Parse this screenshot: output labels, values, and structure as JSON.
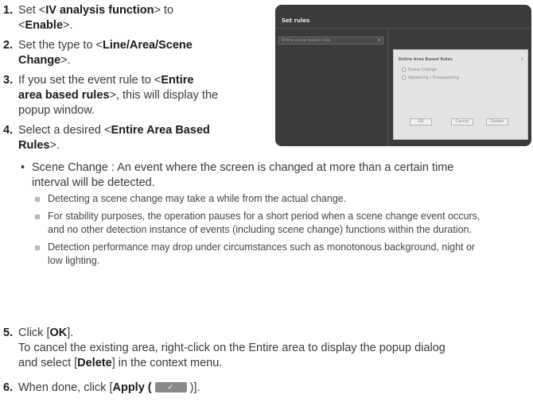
{
  "steps": [
    {
      "num": "1.",
      "parts": [
        [
          "Set <",
          0
        ],
        [
          "IV analysis function",
          1
        ],
        [
          "> to",
          0
        ],
        [
          "<",
          0
        ],
        [
          "Enable",
          1
        ],
        [
          ">.",
          0
        ]
      ],
      "lines": [
        [
          0,
          1,
          2
        ],
        [
          3,
          4,
          5
        ]
      ]
    },
    {
      "num": "2.",
      "parts": [
        [
          "Set the type to <",
          0
        ],
        [
          "Line/Area/Scene",
          1
        ],
        [
          "Change",
          1
        ],
        [
          ">.",
          0
        ]
      ],
      "lines": [
        [
          0,
          1
        ],
        [
          2,
          3
        ]
      ]
    },
    {
      "num": "3.",
      "parts": [
        [
          "If you set the event rule to <",
          0
        ],
        [
          "Entire",
          1
        ],
        [
          "area based rules",
          1
        ],
        [
          ">, this will display the",
          0
        ],
        [
          "popup window.",
          0
        ]
      ],
      "lines": [
        [
          0,
          1
        ],
        [
          2,
          3
        ],
        [
          4
        ]
      ]
    },
    {
      "num": "4.",
      "parts": [
        [
          "Select a desired <",
          0
        ],
        [
          "Entire Area Based",
          1
        ],
        [
          "Rules",
          1
        ],
        [
          ">.",
          0
        ]
      ],
      "lines": [
        [
          0,
          1
        ],
        [
          2,
          3
        ]
      ]
    }
  ],
  "bullet": {
    "symbol": "•",
    "line1": "Scene Change : An event where the screen is changed at more than a certain time",
    "line2": "interval will be detected."
  },
  "notes": [
    {
      "line1": "Detecting a scene change may take a while from the actual change.",
      "line2": ""
    },
    {
      "line1": "For stability purposes, the operation pauses for a short period when a scene change event occurs,",
      "line2": "and no other detection instance of events (including scene change) functions within the duration."
    },
    {
      "line1": "Detection performance may drop under circumstances such as monotonous background, night or",
      "line2": "low lighting."
    }
  ],
  "step5": {
    "num": "5.",
    "pre": "Click [",
    "bold": "OK",
    "post": "].",
    "desc1": "To cancel the existing area, right-click on the Entire area to display the popup dialog",
    "desc2_pre": "and select [",
    "desc2_bold": "Delete",
    "desc2_post": "] in the context menu."
  },
  "step6": {
    "num": "6.",
    "pre": "When done, click [",
    "bold": "Apply (",
    "post": ")].",
    "button_icon": "checkmark-icon",
    "button_glyph": "✓"
  },
  "screenshot": {
    "title": "Set rules",
    "select_placeholder": "Entire scene based rules",
    "select_caret": "▾",
    "popup_title": "Entire Area Based Rules",
    "popup_close": "×",
    "options": [
      "Scene Change",
      "Appearing / Disappearing"
    ],
    "buttons": {
      "ok": "OK",
      "cancel": "Cancel",
      "delete": "Delete"
    },
    "colors": {
      "panel": "#3b3b3b",
      "popup": "#e4e4e4"
    }
  }
}
